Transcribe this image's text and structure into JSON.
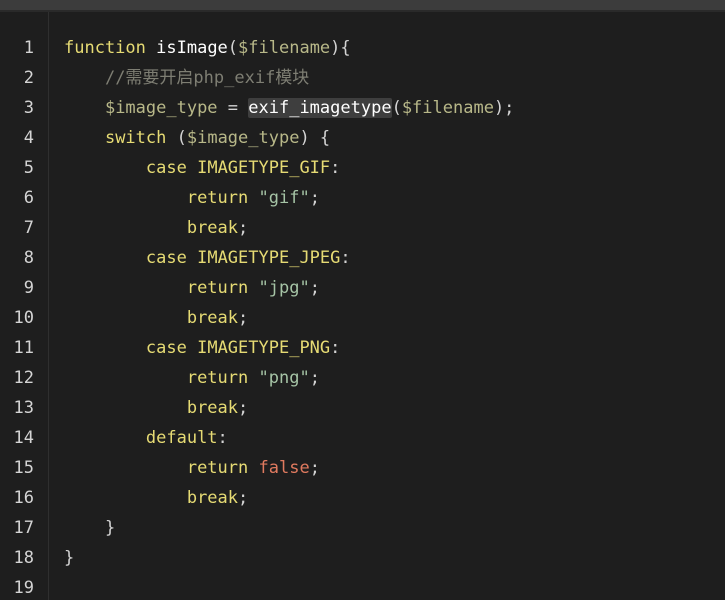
{
  "colors": {
    "background": "#1e1e1e",
    "keyword": "#e6db74",
    "variable": "#b8b889",
    "comment": "#7e7e73",
    "string": "#a6c4a6",
    "boolean": "#e07a5f",
    "plain": "#d4d4d4"
  },
  "lines": [
    {
      "no": "1",
      "tokens": [
        {
          "t": "function",
          "c": "kw"
        },
        {
          "t": " ",
          "c": "plain"
        },
        {
          "t": "isImage",
          "c": "fn"
        },
        {
          "t": "(",
          "c": "plain"
        },
        {
          "t": "$filename",
          "c": "var"
        },
        {
          "t": "){",
          "c": "plain"
        }
      ]
    },
    {
      "no": "2",
      "tokens": [
        {
          "t": "    ",
          "c": "plain"
        },
        {
          "t": "//需要开启php_exif模块",
          "c": "cmt"
        }
      ]
    },
    {
      "no": "3",
      "tokens": [
        {
          "t": "    ",
          "c": "plain"
        },
        {
          "t": "$image_type",
          "c": "var"
        },
        {
          "t": " = ",
          "c": "plain"
        },
        {
          "t": "exif_imagetype",
          "c": "hl"
        },
        {
          "t": "(",
          "c": "plain"
        },
        {
          "t": "$filename",
          "c": "var"
        },
        {
          "t": ");",
          "c": "plain"
        }
      ]
    },
    {
      "no": "4",
      "tokens": [
        {
          "t": "    ",
          "c": "plain"
        },
        {
          "t": "switch",
          "c": "kw"
        },
        {
          "t": " (",
          "c": "plain"
        },
        {
          "t": "$image_type",
          "c": "var"
        },
        {
          "t": ") {",
          "c": "plain"
        }
      ]
    },
    {
      "no": "5",
      "tokens": [
        {
          "t": "        ",
          "c": "plain"
        },
        {
          "t": "case",
          "c": "kw"
        },
        {
          "t": " ",
          "c": "plain"
        },
        {
          "t": "IMAGETYPE_GIF",
          "c": "const"
        },
        {
          "t": ":",
          "c": "plain"
        }
      ]
    },
    {
      "no": "6",
      "tokens": [
        {
          "t": "            ",
          "c": "plain"
        },
        {
          "t": "return",
          "c": "kw"
        },
        {
          "t": " ",
          "c": "plain"
        },
        {
          "t": "\"gif\"",
          "c": "str"
        },
        {
          "t": ";",
          "c": "plain"
        }
      ]
    },
    {
      "no": "7",
      "tokens": [
        {
          "t": "            ",
          "c": "plain"
        },
        {
          "t": "break",
          "c": "kw"
        },
        {
          "t": ";",
          "c": "plain"
        }
      ]
    },
    {
      "no": "8",
      "tokens": [
        {
          "t": "        ",
          "c": "plain"
        },
        {
          "t": "case",
          "c": "kw"
        },
        {
          "t": " ",
          "c": "plain"
        },
        {
          "t": "IMAGETYPE_JPEG",
          "c": "const"
        },
        {
          "t": ":",
          "c": "plain"
        }
      ]
    },
    {
      "no": "9",
      "tokens": [
        {
          "t": "            ",
          "c": "plain"
        },
        {
          "t": "return",
          "c": "kw"
        },
        {
          "t": " ",
          "c": "plain"
        },
        {
          "t": "\"jpg\"",
          "c": "str"
        },
        {
          "t": ";",
          "c": "plain"
        }
      ]
    },
    {
      "no": "10",
      "tokens": [
        {
          "t": "            ",
          "c": "plain"
        },
        {
          "t": "break",
          "c": "kw"
        },
        {
          "t": ";",
          "c": "plain"
        }
      ]
    },
    {
      "no": "11",
      "tokens": [
        {
          "t": "        ",
          "c": "plain"
        },
        {
          "t": "case",
          "c": "kw"
        },
        {
          "t": " ",
          "c": "plain"
        },
        {
          "t": "IMAGETYPE_PNG",
          "c": "const"
        },
        {
          "t": ":",
          "c": "plain"
        }
      ]
    },
    {
      "no": "12",
      "tokens": [
        {
          "t": "            ",
          "c": "plain"
        },
        {
          "t": "return",
          "c": "kw"
        },
        {
          "t": " ",
          "c": "plain"
        },
        {
          "t": "\"png\"",
          "c": "str"
        },
        {
          "t": ";",
          "c": "plain"
        }
      ]
    },
    {
      "no": "13",
      "tokens": [
        {
          "t": "            ",
          "c": "plain"
        },
        {
          "t": "break",
          "c": "kw"
        },
        {
          "t": ";",
          "c": "plain"
        }
      ]
    },
    {
      "no": "14",
      "tokens": [
        {
          "t": "        ",
          "c": "plain"
        },
        {
          "t": "default",
          "c": "kw"
        },
        {
          "t": ":",
          "c": "plain"
        }
      ]
    },
    {
      "no": "15",
      "tokens": [
        {
          "t": "            ",
          "c": "plain"
        },
        {
          "t": "return",
          "c": "kw"
        },
        {
          "t": " ",
          "c": "plain"
        },
        {
          "t": "false",
          "c": "bool"
        },
        {
          "t": ";",
          "c": "plain"
        }
      ]
    },
    {
      "no": "16",
      "tokens": [
        {
          "t": "            ",
          "c": "plain"
        },
        {
          "t": "break",
          "c": "kw"
        },
        {
          "t": ";",
          "c": "plain"
        }
      ]
    },
    {
      "no": "17",
      "tokens": [
        {
          "t": "    ",
          "c": "plain"
        },
        {
          "t": "}",
          "c": "plain"
        }
      ]
    },
    {
      "no": "18",
      "tokens": [
        {
          "t": "}",
          "c": "plain"
        }
      ]
    },
    {
      "no": "19",
      "tokens": []
    }
  ]
}
